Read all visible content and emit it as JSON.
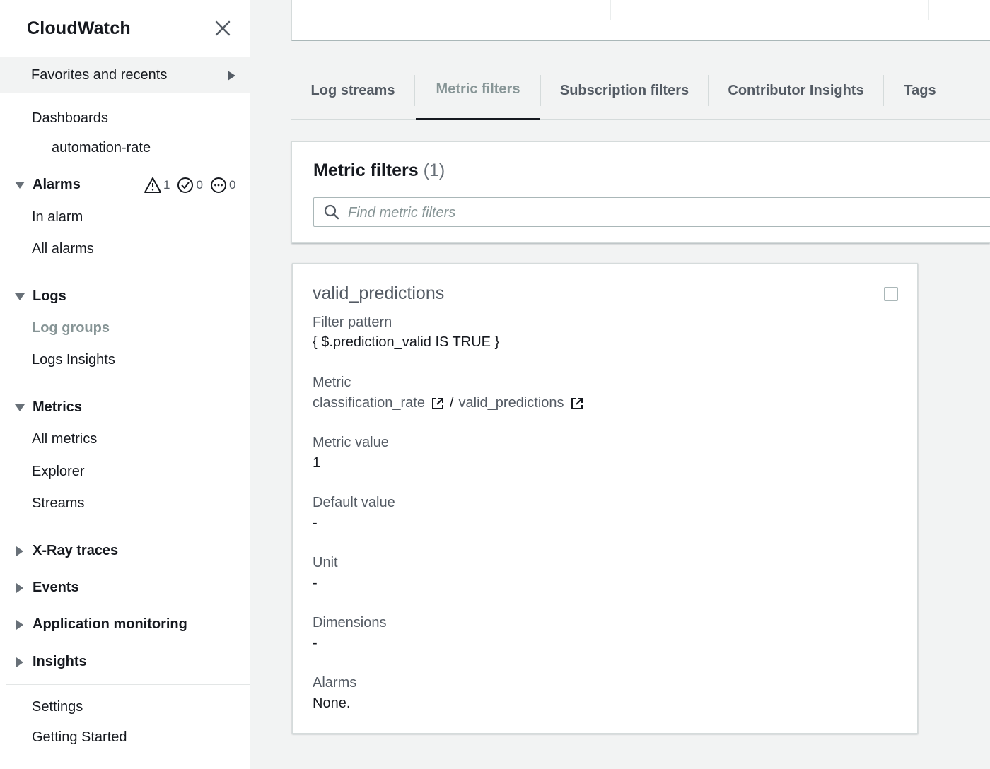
{
  "sidebar": {
    "title": "CloudWatch",
    "favorites_label": "Favorites and recents",
    "dashboards": "Dashboards",
    "dashboard_item": "automation-rate",
    "alarms": {
      "label": "Alarms",
      "in_alarm_count": "1",
      "ok_count": "0",
      "insufficient_count": "0",
      "in_alarm": "In alarm",
      "all_alarms": "All alarms"
    },
    "logs": {
      "label": "Logs",
      "log_groups": "Log groups",
      "logs_insights": "Logs Insights"
    },
    "metrics": {
      "label": "Metrics",
      "all_metrics": "All metrics",
      "explorer": "Explorer",
      "streams": "Streams"
    },
    "xray": "X-Ray traces",
    "events": "Events",
    "app_monitoring": "Application monitoring",
    "insights": "Insights",
    "settings": "Settings",
    "getting_started": "Getting Started"
  },
  "tabs": [
    {
      "label": "Log streams"
    },
    {
      "label": "Metric filters"
    },
    {
      "label": "Subscription filters"
    },
    {
      "label": "Contributor Insights"
    },
    {
      "label": "Tags"
    }
  ],
  "active_tab": "Metric filters",
  "metric_filters": {
    "title": "Metric filters",
    "count": "(1)",
    "search_placeholder": "Find metric filters"
  },
  "filter_card": {
    "name": "valid_predictions",
    "filter_pattern_label": "Filter pattern",
    "filter_pattern": "{ $.prediction_valid IS TRUE }",
    "metric_label": "Metric",
    "metric_namespace": "classification_rate",
    "metric_separator": "/",
    "metric_name": "valid_predictions",
    "metric_value_label": "Metric value",
    "metric_value": "1",
    "default_value_label": "Default value",
    "default_value": "-",
    "unit_label": "Unit",
    "unit": "-",
    "dimensions_label": "Dimensions",
    "dimensions": "-",
    "alarms_label": "Alarms",
    "alarms": "None."
  },
  "colors": {
    "text_primary": "#16191f",
    "text_secondary": "#545b64",
    "active_muted": "#879596",
    "background": "#f2f3f3"
  }
}
